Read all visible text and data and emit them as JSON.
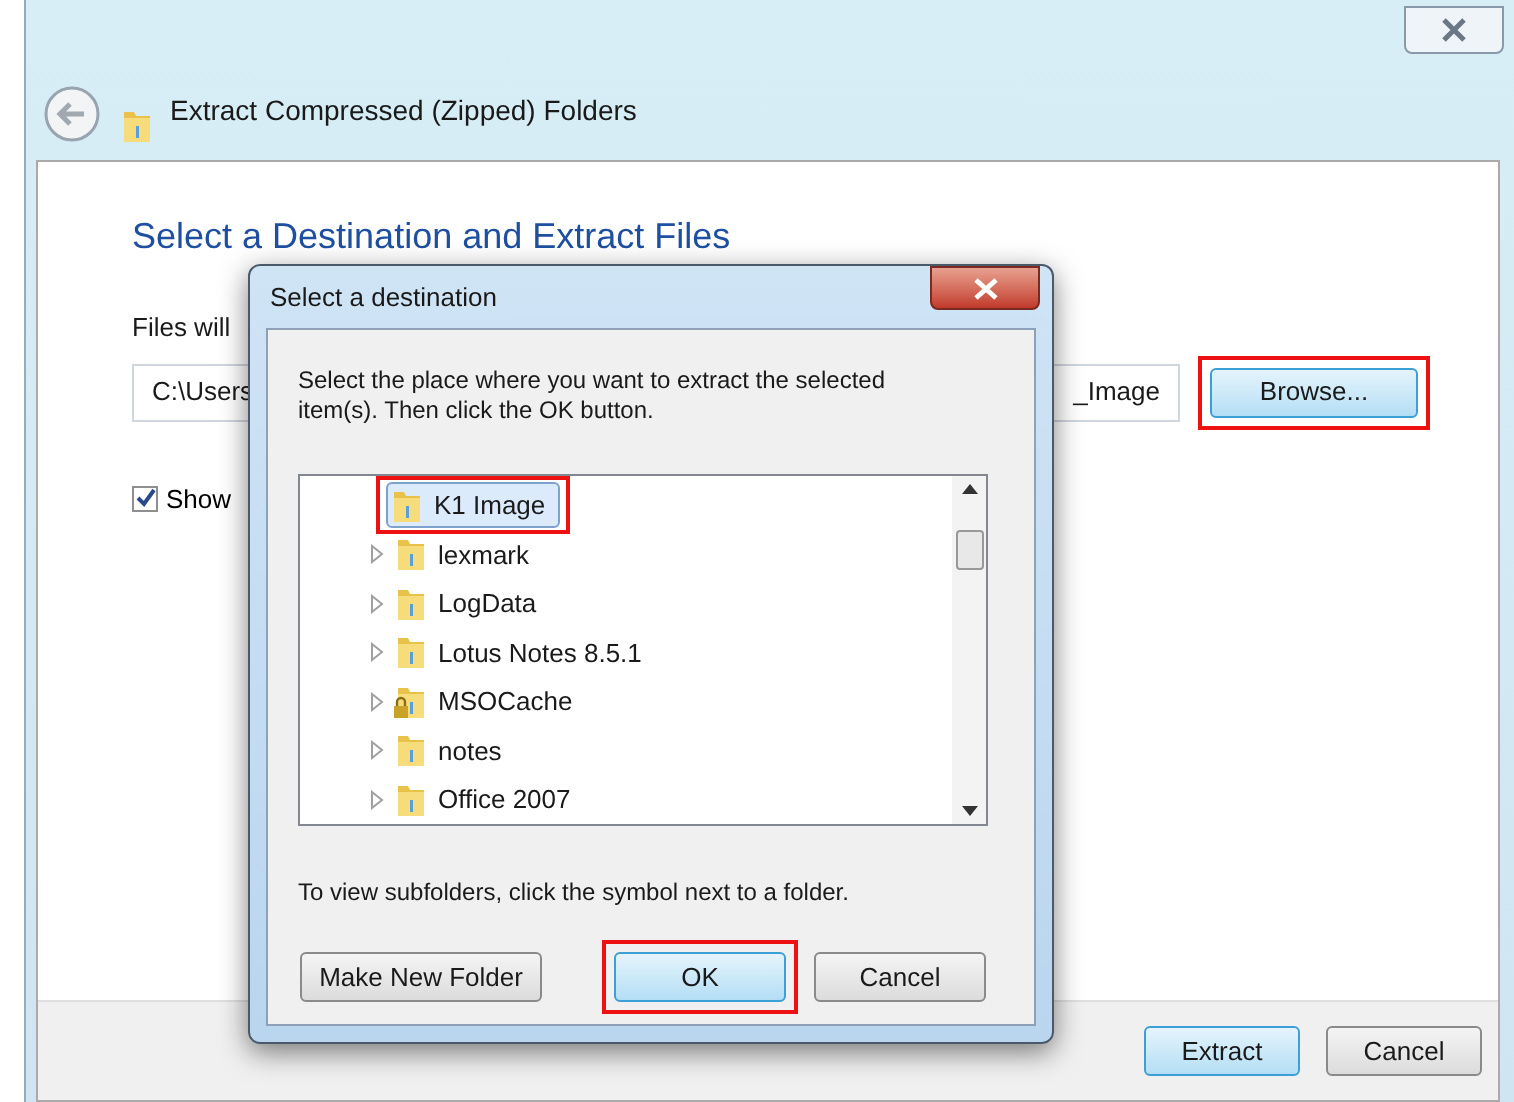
{
  "window": {
    "title": "Extract Compressed (Zipped) Folders"
  },
  "heading": "Select a Destination and Extract Files",
  "destination": {
    "label": "Files will",
    "value_start": "C:\\Users",
    "value_end": "_Image"
  },
  "browse_button": {
    "label": "Browse...",
    "default": true,
    "annotated": true
  },
  "show_checkbox": {
    "label": "Show",
    "checked": true
  },
  "footer_buttons": [
    {
      "label": "Extract",
      "default": true,
      "annotated": false
    },
    {
      "label": "Cancel",
      "default": false,
      "annotated": false
    }
  ],
  "dialog": {
    "title": "Select a destination",
    "instructions": "Select the place where you want to extract the selected item(s).  Then click the OK button.",
    "tree": [
      {
        "label": "K1 Image",
        "kind": "folder",
        "has_children": false,
        "selected": true,
        "annotated": true
      },
      {
        "label": "lexmark",
        "kind": "folder",
        "has_children": true,
        "selected": false,
        "annotated": false
      },
      {
        "label": "LogData",
        "kind": "folder",
        "has_children": true,
        "selected": false,
        "annotated": false
      },
      {
        "label": "Lotus Notes 8.5.1",
        "kind": "folder",
        "has_children": true,
        "selected": false,
        "annotated": false
      },
      {
        "label": "MSOCache",
        "kind": "locked-folder",
        "has_children": true,
        "selected": false,
        "annotated": false
      },
      {
        "label": "notes",
        "kind": "folder",
        "has_children": true,
        "selected": false,
        "annotated": false
      },
      {
        "label": "Office 2007",
        "kind": "folder",
        "has_children": true,
        "selected": false,
        "annotated": false
      }
    ],
    "hint": "To view subfolders, click the symbol next to a folder.",
    "buttons": [
      {
        "label": "Make New Folder",
        "default": false,
        "annotated": false
      },
      {
        "label": "OK",
        "default": true,
        "annotated": true
      },
      {
        "label": "Cancel",
        "default": false,
        "annotated": false
      }
    ]
  }
}
